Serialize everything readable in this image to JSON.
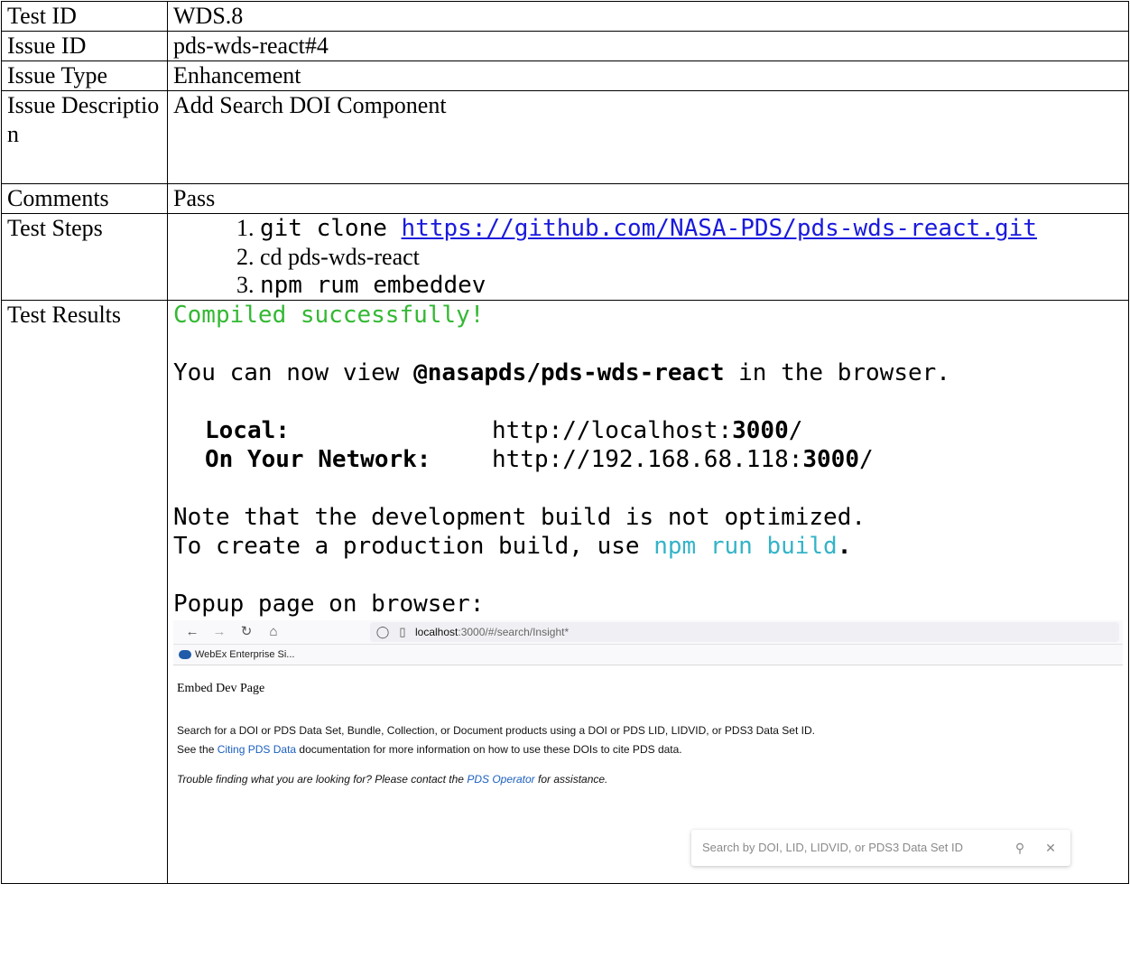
{
  "rows": {
    "test_id": {
      "label": "Test ID",
      "value": "WDS.8"
    },
    "issue_id": {
      "label": "Issue ID",
      "value": "pds-wds-react#4"
    },
    "issue_type": {
      "label": "Issue Type",
      "value": "Enhancement"
    },
    "issue_description": {
      "label": "Issue Description",
      "value": "Add Search DOI Component"
    },
    "comments": {
      "label": "Comments",
      "value": "Pass"
    },
    "test_steps": {
      "label": "Test Steps",
      "step1_prefix": "git clone ",
      "step1_link": "https://github.com/NASA-PDS/pds-wds-react.git",
      "step2": "cd pds-wds-react",
      "step3": "npm rum embeddev"
    },
    "test_results": {
      "label": "Test Results"
    }
  },
  "terminal": {
    "compiled": "Compiled successfully!",
    "view_prefix": "You can now view ",
    "view_pkg": "@nasapds/pds-wds-react",
    "view_suffix": " in the browser.",
    "local_label": "Local:",
    "local_url_prefix": "http://localhost:",
    "local_port": "3000",
    "local_url_suffix": "/",
    "network_label": "On Your Network:",
    "network_url_prefix": "http://192.168.68.118:",
    "network_port": "3000",
    "network_url_suffix": "/",
    "note1": "Note that the development build is not optimized.",
    "note2_prefix": "To create a production build, use ",
    "note2_cmd": "npm run build",
    "note2_suffix": ".",
    "popup": "Popup page on browser:"
  },
  "browser": {
    "url_host": "localhost",
    "url_path": ":3000/#/search/Insight*",
    "bookmark": "WebEx Enterprise Si...",
    "page_title": "Embed Dev Page",
    "line1": "Search for a DOI or PDS Data Set, Bundle, Collection, or Document products using a DOI or PDS LID, LIDVID, or PDS3 Data Set ID.",
    "line2_prefix": "See the ",
    "line2_link": "Citing PDS Data",
    "line2_suffix": " documentation for more information on how to use these DOIs to cite PDS data.",
    "line3_prefix": "Trouble finding what you are looking for? Please contact the ",
    "line3_link": "PDS Operator",
    "line3_suffix": " for assistance.",
    "search_placeholder": "Search by DOI, LID, LIDVID, or PDS3 Data Set ID"
  }
}
